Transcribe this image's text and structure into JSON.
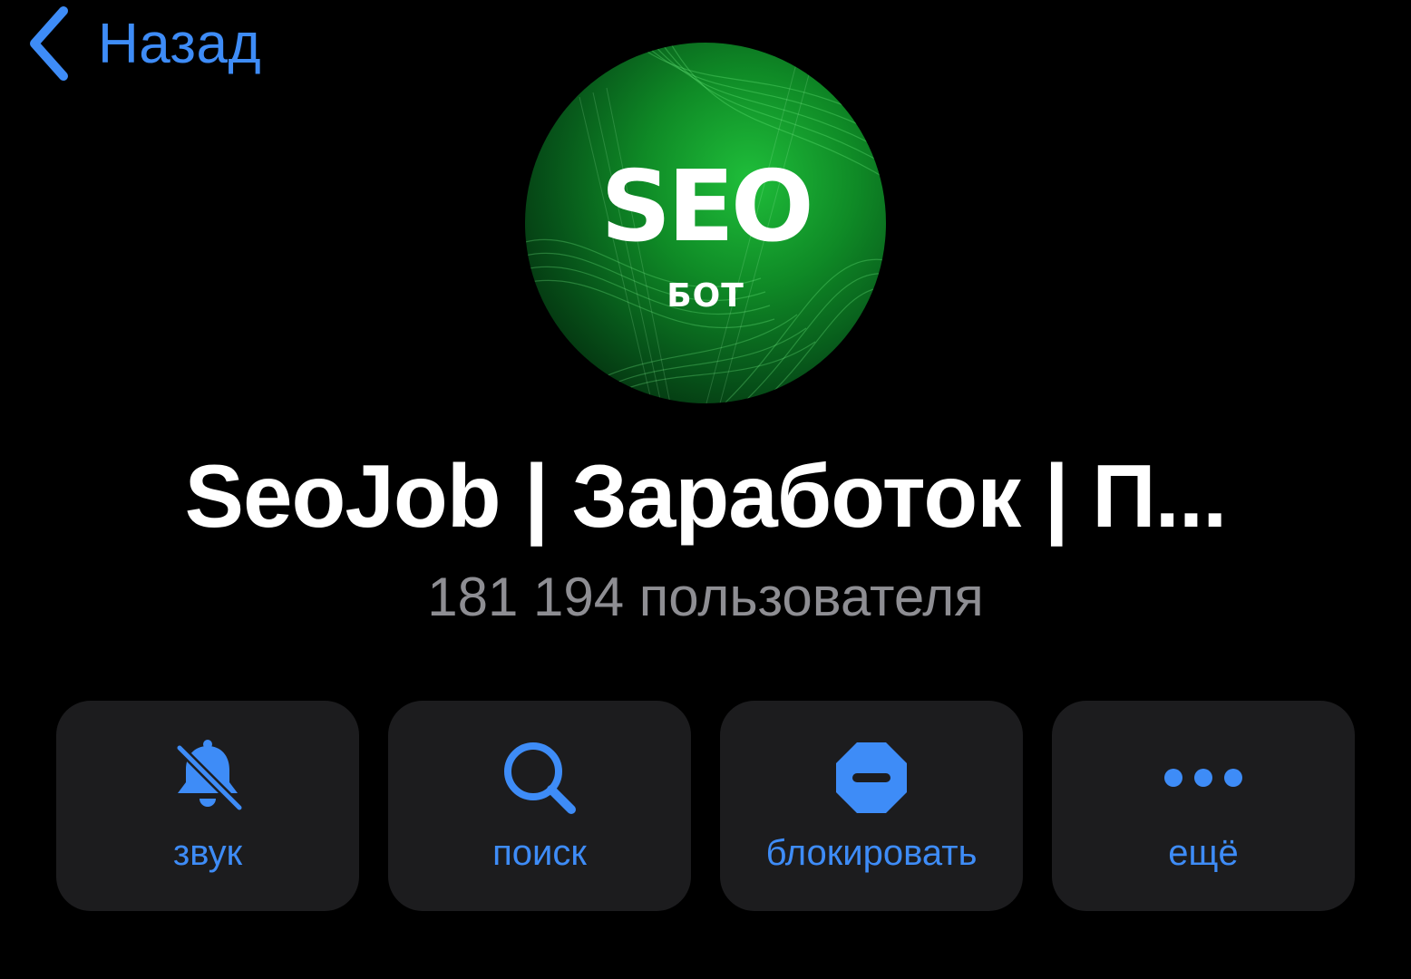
{
  "colors": {
    "accent": "#3e8cf7",
    "background": "#000000",
    "card": "#1c1c1e",
    "secondary_text": "#8e8e93",
    "avatar_green": "#1fbe3a"
  },
  "nav": {
    "back_icon": "chevron-left-icon",
    "back_label": "Назад"
  },
  "profile": {
    "avatar": {
      "logo_text": "SEO",
      "logo_subtext": "БОТ"
    },
    "title": "SeoJob | Заработок | П...",
    "subtitle": "181 194 пользователя"
  },
  "actions": [
    {
      "icon": "bell-slash-icon",
      "label": "звук"
    },
    {
      "icon": "search-icon",
      "label": "поиск"
    },
    {
      "icon": "block-icon",
      "label": "блокировать"
    },
    {
      "icon": "more-icon",
      "label": "ещё"
    }
  ]
}
